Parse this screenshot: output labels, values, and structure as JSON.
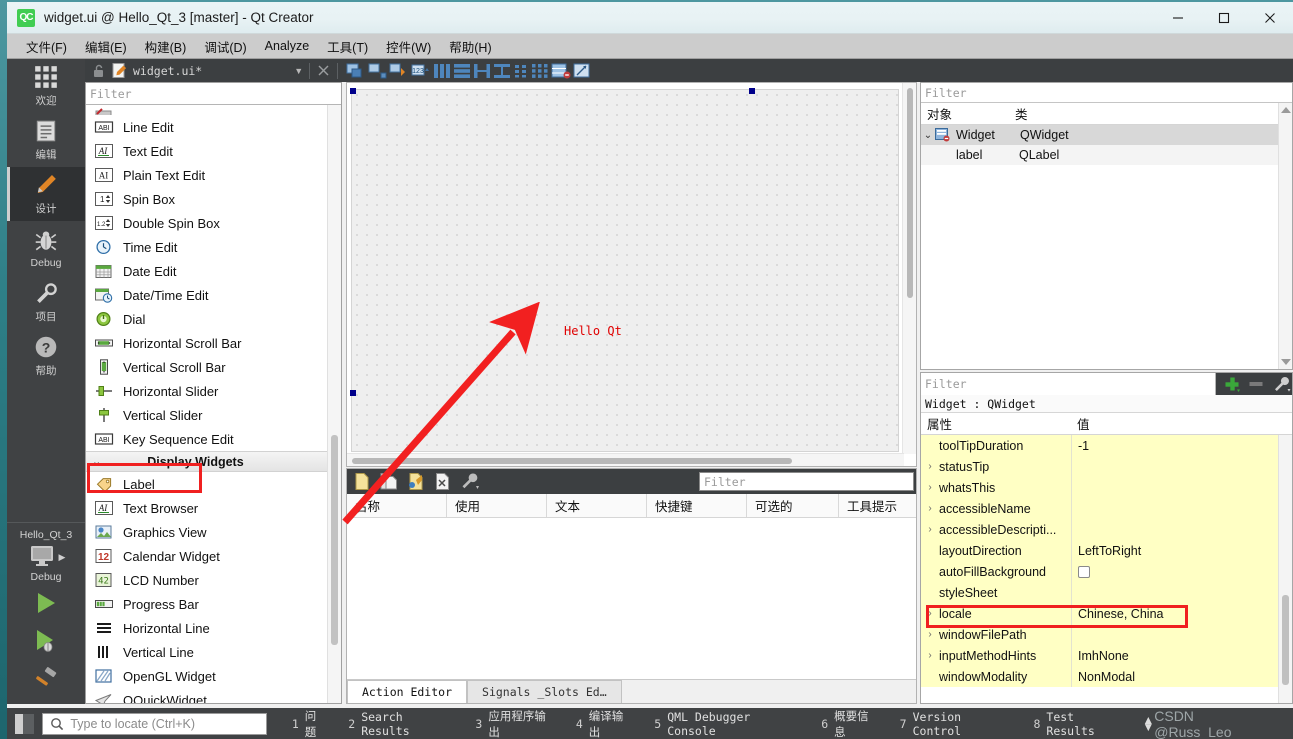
{
  "window": {
    "app_icon": "qt-creator-icon",
    "title": "widget.ui @ Hello_Qt_3 [master] - Qt Creator",
    "minimize": "–",
    "maximize": "□",
    "close": "✕"
  },
  "menubar": {
    "items": [
      {
        "label": "文件(F)"
      },
      {
        "label": "编辑(E)"
      },
      {
        "label": "构建(B)"
      },
      {
        "label": "调试(D)"
      },
      {
        "label": "Analyze"
      },
      {
        "label": "工具(T)"
      },
      {
        "label": "控件(W)"
      },
      {
        "label": "帮助(H)"
      }
    ]
  },
  "modebar": {
    "items": [
      {
        "label": "欢迎",
        "icon": "grid-icon",
        "active": false
      },
      {
        "label": "编辑",
        "icon": "document-icon",
        "active": false
      },
      {
        "label": "设计",
        "icon": "pencil-icon",
        "active": true
      },
      {
        "label": "Debug",
        "icon": "bug-icon",
        "active": false
      },
      {
        "label": "项目",
        "icon": "wrench-icon",
        "active": false
      },
      {
        "label": "帮助",
        "icon": "question-icon",
        "active": false
      }
    ],
    "run_section": {
      "kit_name": "Hello_Qt_3",
      "build_config": "Debug",
      "target_icon": "monitor-icon",
      "run_icon": "run-green-triangle-icon",
      "debug_icon": "debug-green-triangle-bug-icon",
      "build_icon": "hammer-icon"
    }
  },
  "designer_toolbar": {
    "lock_icon": "unlocked-padlock-icon",
    "file_icon": "ui-file-icon",
    "file_name": "widget.ui*",
    "dropdown_icon": "chevron-down-icon",
    "close_icon": "close-x-icon",
    "tools": [
      "edit-widgets-icon",
      "edit-signals-slots-icon",
      "edit-buddies-icon",
      "edit-tab-order-icon",
      "layout-horizontally-icon",
      "layout-vertically-icon",
      "layout-splitter-horizontal-icon",
      "layout-splitter-vertical-icon",
      "layout-form-icon",
      "layout-grid-icon",
      "break-layout-icon",
      "adjust-size-icon"
    ]
  },
  "widget_box": {
    "filter_placeholder": "Filter",
    "items": [
      {
        "label": "Line Edit",
        "icon": "line-edit-icon",
        "type": "item"
      },
      {
        "label": "Text Edit",
        "icon": "text-edit-icon",
        "type": "item"
      },
      {
        "label": "Plain Text Edit",
        "icon": "plain-text-edit-icon",
        "type": "item"
      },
      {
        "label": "Spin Box",
        "icon": "spin-box-icon",
        "type": "item"
      },
      {
        "label": "Double Spin Box",
        "icon": "double-spin-box-icon",
        "type": "item"
      },
      {
        "label": "Time Edit",
        "icon": "time-edit-clock-icon",
        "type": "item"
      },
      {
        "label": "Date Edit",
        "icon": "date-edit-calendar-icon",
        "type": "item"
      },
      {
        "label": "Date/Time Edit",
        "icon": "date-time-edit-icon",
        "type": "item"
      },
      {
        "label": "Dial",
        "icon": "dial-icon",
        "type": "item"
      },
      {
        "label": "Horizontal Scroll Bar",
        "icon": "horizontal-scroll-bar-icon",
        "type": "item"
      },
      {
        "label": "Vertical Scroll Bar",
        "icon": "vertical-scroll-bar-icon",
        "type": "item"
      },
      {
        "label": "Horizontal Slider",
        "icon": "horizontal-slider-icon",
        "type": "item"
      },
      {
        "label": "Vertical Slider",
        "icon": "vertical-slider-icon",
        "type": "item"
      },
      {
        "label": "Key Sequence Edit",
        "icon": "key-sequence-edit-icon",
        "type": "item"
      },
      {
        "label": "Display Widgets",
        "icon": "chevron-down-icon",
        "type": "group"
      },
      {
        "label": "Label",
        "icon": "label-icon",
        "type": "item",
        "highlighted": true
      },
      {
        "label": "Text Browser",
        "icon": "text-browser-icon",
        "type": "item"
      },
      {
        "label": "Graphics View",
        "icon": "graphics-view-icon",
        "type": "item"
      },
      {
        "label": "Calendar Widget",
        "icon": "calendar-widget-icon",
        "type": "item"
      },
      {
        "label": "LCD Number",
        "icon": "lcd-number-icon",
        "type": "item"
      },
      {
        "label": "Progress Bar",
        "icon": "progress-bar-icon",
        "type": "item"
      },
      {
        "label": "Horizontal Line",
        "icon": "horizontal-line-icon",
        "type": "item"
      },
      {
        "label": "Vertical Line",
        "icon": "vertical-line-icon",
        "type": "item"
      },
      {
        "label": "OpenGL Widget",
        "icon": "opengl-widget-icon",
        "type": "item"
      },
      {
        "label": "QQuickWidget",
        "icon": "qquickwidget-icon",
        "type": "item"
      }
    ]
  },
  "form_canvas": {
    "label_text": "Hello Qt",
    "label_color": "#e00000",
    "selection_handles": 3,
    "annotation": {
      "type": "red-arrow",
      "color": "#f02020"
    }
  },
  "action_editor": {
    "toolbar_icons": [
      "new-action-icon",
      "copy-action-icon",
      "edit-action-icon",
      "delete-action-icon",
      "configure-icon"
    ],
    "filter_placeholder": "Filter",
    "columns": [
      "名称",
      "使用",
      "文本",
      "快捷键",
      "可选的",
      "工具提示"
    ],
    "rows": [],
    "tabs": [
      {
        "label": "Action Editor",
        "active": true
      },
      {
        "label": "Signals _Slots Ed…",
        "active": false
      }
    ]
  },
  "object_inspector": {
    "filter_placeholder": "Filter",
    "columns": [
      "对象",
      "类"
    ],
    "rows": [
      {
        "name": "Widget",
        "class": "QWidget",
        "icon": "qwidget-icon",
        "indent": 0,
        "expanded": true,
        "selected": true
      },
      {
        "name": "label",
        "class": "QLabel",
        "icon": "",
        "indent": 1,
        "expanded": false,
        "selected": false
      }
    ]
  },
  "property_editor": {
    "filter_placeholder": "Filter",
    "tools": [
      "add-property-icon",
      "remove-property-icon",
      "configure-wrench-icon"
    ],
    "object_line": "Widget : QWidget",
    "columns": [
      "属性",
      "值"
    ],
    "rows": [
      {
        "name": "toolTipDuration",
        "value": "-1",
        "expandable": false
      },
      {
        "name": "statusTip",
        "value": "",
        "expandable": true
      },
      {
        "name": "whatsThis",
        "value": "",
        "expandable": true
      },
      {
        "name": "accessibleName",
        "value": "",
        "expandable": true
      },
      {
        "name": "accessibleDescripti...",
        "value": "",
        "expandable": true
      },
      {
        "name": "layoutDirection",
        "value": "LeftToRight",
        "expandable": false
      },
      {
        "name": "autoFillBackground",
        "value": "",
        "expandable": false,
        "checkbox": true,
        "checked": false
      },
      {
        "name": "styleSheet",
        "value": "",
        "expandable": false
      },
      {
        "name": "locale",
        "value": "Chinese, China",
        "expandable": true,
        "highlighted": true
      },
      {
        "name": "windowFilePath",
        "value": "",
        "expandable": true
      },
      {
        "name": "inputMethodHints",
        "value": "ImhNone",
        "expandable": true
      },
      {
        "name": "windowModality",
        "value": "NonModal",
        "expandable": false
      }
    ]
  },
  "statusbar": {
    "sidebar_toggle_icon": "sidebar-toggle-icon",
    "search_icon": "search-magnifier-icon",
    "locator_placeholder": "Type to locate (Ctrl+K)",
    "panes": [
      {
        "num": "1",
        "label": "问题"
      },
      {
        "num": "2",
        "label": "Search Results"
      },
      {
        "num": "3",
        "label": "应用程序输出"
      },
      {
        "num": "4",
        "label": "编译输出"
      },
      {
        "num": "5",
        "label": "QML Debugger Console"
      },
      {
        "num": "6",
        "label": "概要信息"
      },
      {
        "num": "7",
        "label": "Version Control"
      },
      {
        "num": "8",
        "label": "Test Results"
      }
    ],
    "watermark": "CSDN @Russ_Leo"
  },
  "colors": {
    "accent_green": "#41cd52",
    "dark_panel": "#3c3f41",
    "mode_bar": "#404244",
    "property_yellow": "#ffffc4",
    "highlight_red": "#f02020",
    "desktop_teal": "#2e7f87"
  }
}
